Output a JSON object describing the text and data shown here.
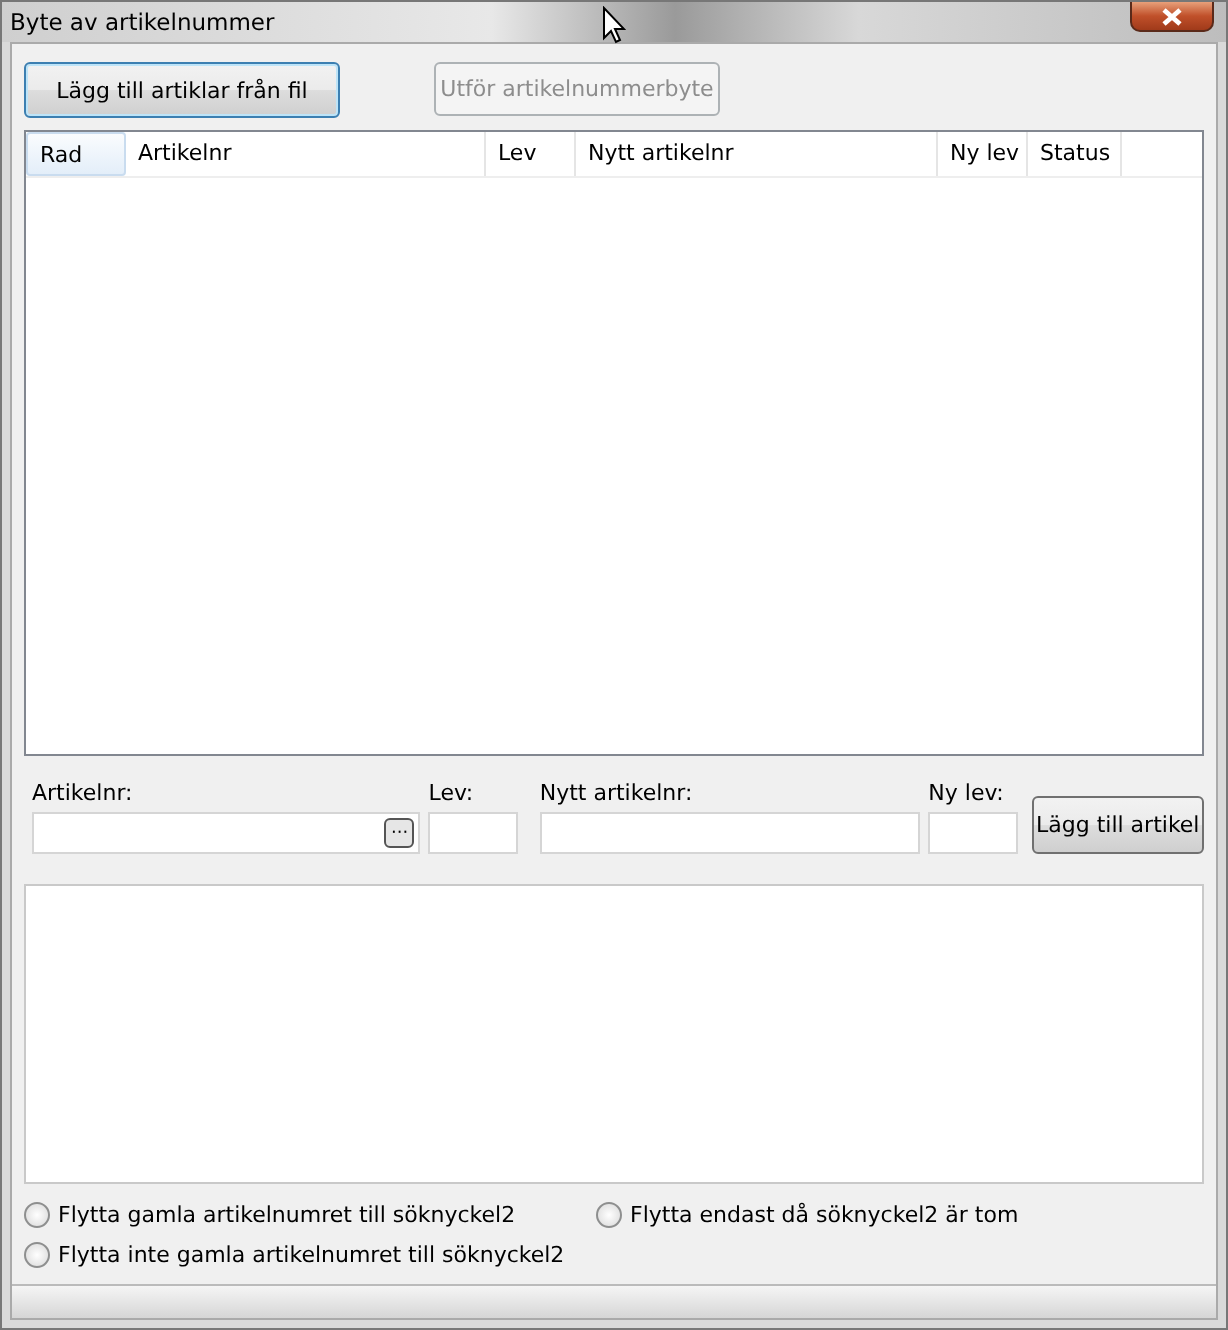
{
  "window": {
    "title": "Byte av artikelnummer"
  },
  "toolbar": [
    {
      "label": "Lägg till artiklar från fil",
      "disabled": false,
      "focused": true
    },
    {
      "label": "Utför artikelnummerbyte",
      "disabled": true,
      "focused": false
    }
  ],
  "table": {
    "columns": [
      {
        "label": "Rad",
        "selected": true
      },
      {
        "label": "Artikelnr",
        "selected": false
      },
      {
        "label": "Lev",
        "selected": false
      },
      {
        "label": "Nytt artikelnr",
        "selected": false
      },
      {
        "label": "Ny lev",
        "selected": false
      },
      {
        "label": "Status",
        "selected": false
      }
    ]
  },
  "form": {
    "fields": [
      {
        "label": "Artikelnr:",
        "kind": "browse",
        "browse_label": "···"
      },
      {
        "label": "Lev:",
        "kind": "plain"
      },
      {
        "label": "Nytt artikelnr:",
        "kind": "plain"
      },
      {
        "label": "Ny lev:",
        "kind": "plain"
      }
    ],
    "add_button": "Lägg till artikel"
  },
  "options": [
    {
      "label": "Flytta gamla artikelnumret till söknyckel2",
      "selected": false
    },
    {
      "label": "Flytta endast då söknyckel2 är tom",
      "selected": false
    },
    {
      "label": "Flytta inte gamla artikelnumret till söknyckel2",
      "selected": false
    }
  ]
}
